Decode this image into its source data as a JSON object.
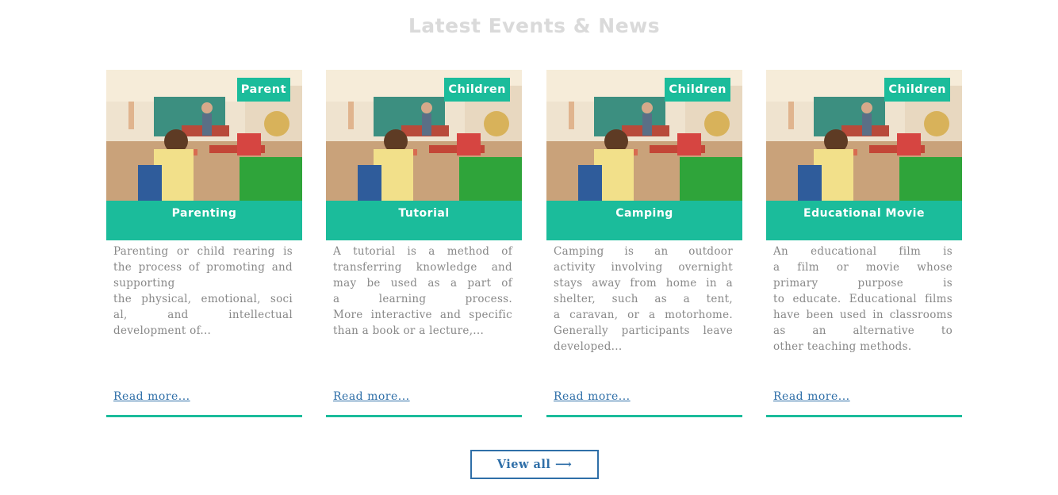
{
  "section": {
    "title": "Latest Events & News"
  },
  "cards": [
    {
      "tag": "Parent",
      "title": "Parenting",
      "desc_lines": [
        "Parenting or child rearing is",
        "the process of promoting and",
        "supporting",
        "the physical, emotional, soci",
        "al, and intellectual",
        "development of..."
      ],
      "read_more": "Read more..."
    },
    {
      "tag": "Children",
      "title": "Tutorial",
      "desc_lines": [
        "A tutorial is a method of",
        "transferring knowledge and",
        "may be used as a part of",
        "a learning process.",
        "More interactive and specific",
        "than a book or a lecture,..."
      ],
      "read_more": "Read more..."
    },
    {
      "tag": "Children",
      "title": "Camping",
      "desc_lines": [
        "Camping is an outdoor",
        "activity involving overnight",
        "stays away from home in a",
        "shelter, such as a tent,",
        "a caravan, or a motorhome.",
        "Generally participants leave",
        "developed..."
      ],
      "read_more": "Read more..."
    },
    {
      "tag": "Children",
      "title": "Educational Movie",
      "desc_lines": [
        "An educational film is",
        "a film or movie whose",
        "primary purpose is",
        "to educate. Educational films",
        "have been used in classrooms",
        "as an alternative to",
        "other teaching methods."
      ],
      "read_more": "Read more..."
    }
  ],
  "view_all": {
    "label": "View all",
    "icon": "arrow-right-icon"
  },
  "colors": {
    "accent": "#1bbc9b",
    "link": "#2f6fa8",
    "heading": "#dadada",
    "text": "#888888"
  }
}
